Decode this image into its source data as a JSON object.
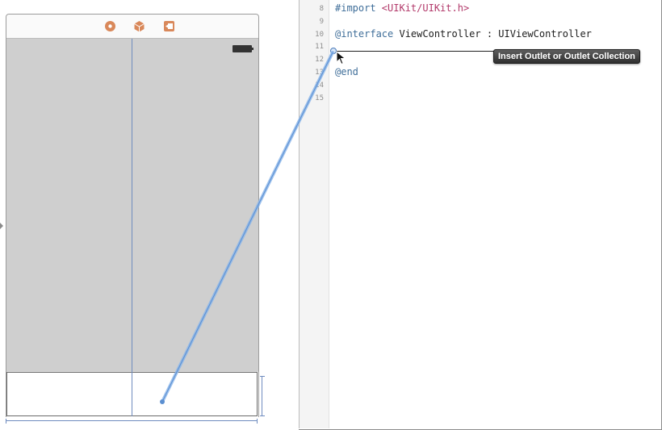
{
  "storyboard": {
    "dock_icons": [
      "view-controller-icon",
      "first-responder-icon",
      "exit-icon"
    ],
    "accent_color": "#d9885a"
  },
  "editor": {
    "lines": [
      {
        "number": "8",
        "tokens": [
          {
            "text": "#import ",
            "style": "kw"
          },
          {
            "text": "<UIKit/UIKit.h>",
            "style": "str"
          }
        ]
      },
      {
        "number": "9",
        "tokens": []
      },
      {
        "number": "10",
        "tokens": [
          {
            "text": "@interface",
            "style": "kw"
          },
          {
            "text": " ViewController : UIViewController",
            "style": ""
          }
        ]
      },
      {
        "number": "11",
        "tokens": []
      },
      {
        "number": "12",
        "tokens": []
      },
      {
        "number": "13",
        "tokens": [
          {
            "text": "@end",
            "style": "kw"
          }
        ]
      },
      {
        "number": "14",
        "tokens": []
      },
      {
        "number": "15",
        "tokens": []
      }
    ],
    "tooltip": "Insert Outlet or Outlet Collection",
    "connection_color": "#8db7ea"
  }
}
